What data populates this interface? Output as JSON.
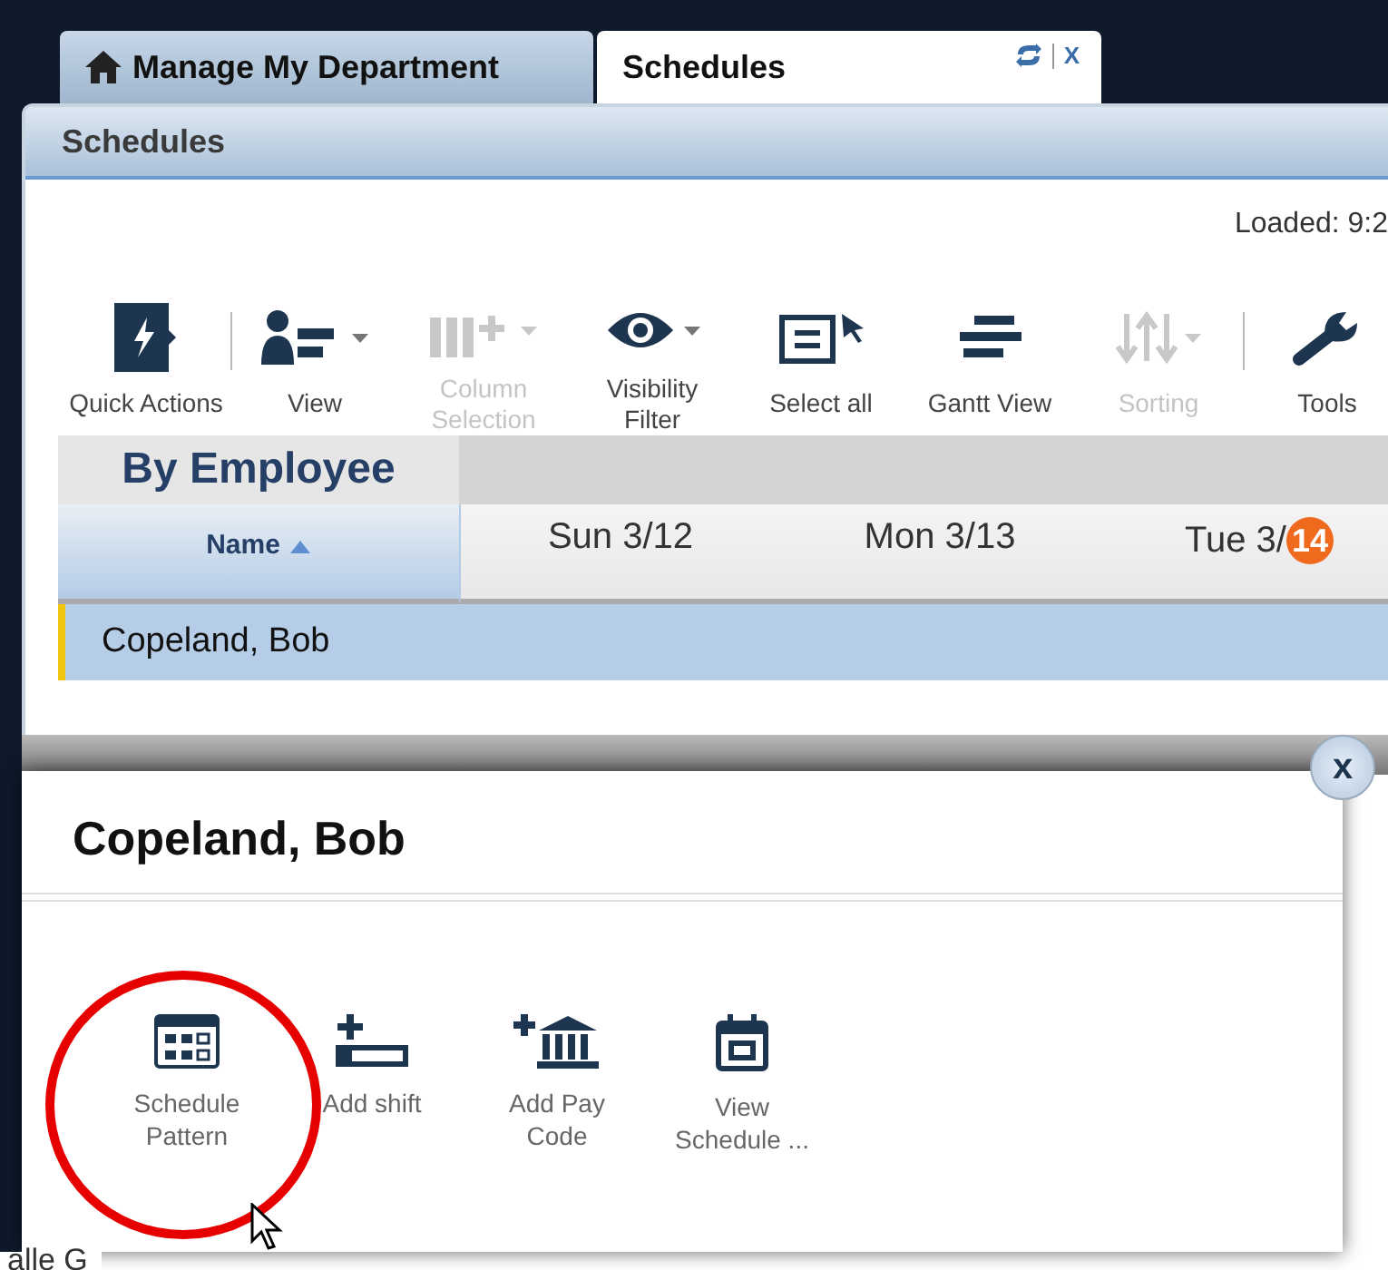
{
  "tabs": [
    {
      "label": "Manage My Department",
      "selected": false
    },
    {
      "label": "Schedules",
      "selected": true,
      "close": "X"
    }
  ],
  "panel": {
    "title": "Schedules",
    "loaded": "Loaded: 9:2"
  },
  "toolbar": [
    {
      "label": "Quick Actions",
      "disabled": false,
      "dropdown": false,
      "separator_before": false
    },
    {
      "label": "View",
      "disabled": false,
      "dropdown": true,
      "separator_before": true
    },
    {
      "label": "Column Selection",
      "disabled": true,
      "dropdown": true,
      "separator_before": false
    },
    {
      "label": "Visibility Filter",
      "disabled": false,
      "dropdown": true,
      "separator_before": false
    },
    {
      "label": "Select all",
      "disabled": false,
      "dropdown": false,
      "separator_before": false
    },
    {
      "label": "Gantt View",
      "disabled": false,
      "dropdown": false,
      "separator_before": false
    },
    {
      "label": "Sorting",
      "disabled": true,
      "dropdown": true,
      "separator_before": false
    },
    {
      "label": "Tools",
      "disabled": false,
      "dropdown": false,
      "separator_before": true
    }
  ],
  "grid": {
    "group_title": "By Employee",
    "name_column": "Name",
    "days": [
      {
        "label": "Sun 3/12"
      },
      {
        "label": "Mon 3/13"
      },
      {
        "label": "Tue 3/",
        "badge": "14"
      }
    ],
    "rows": [
      {
        "name": "Copeland, Bob",
        "selected": true
      }
    ],
    "cut_row": "alle G"
  },
  "popup": {
    "title": "Copeland, Bob",
    "close": "x",
    "actions": [
      {
        "label": "Schedule Pattern",
        "highlighted": true
      },
      {
        "label": "Add shift",
        "highlighted": false
      },
      {
        "label": "Add Pay Code",
        "highlighted": false
      },
      {
        "label": "View Schedule ...",
        "highlighted": false
      }
    ]
  }
}
